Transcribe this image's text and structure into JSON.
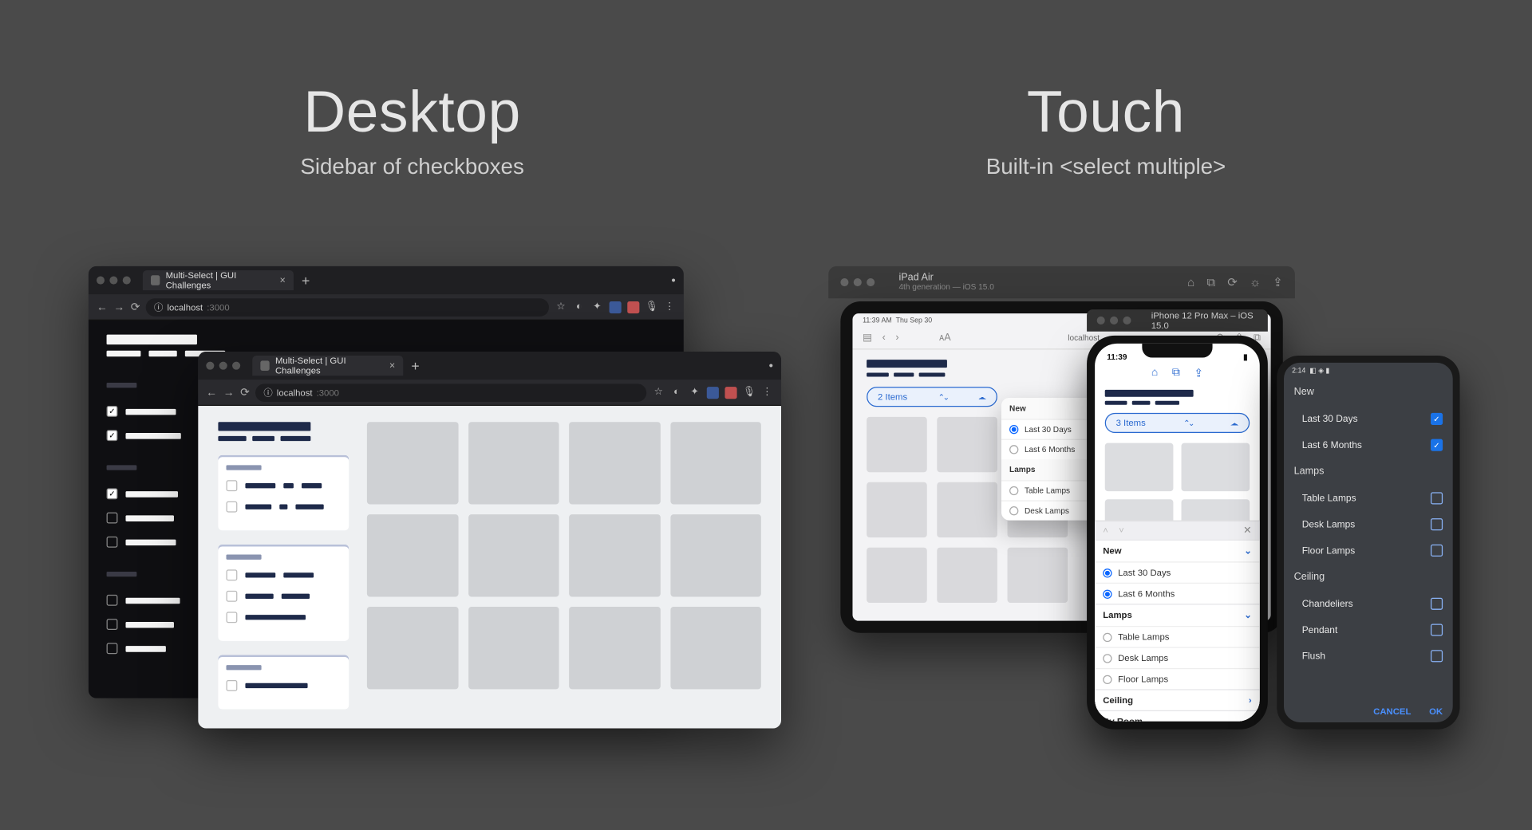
{
  "headings": {
    "desktop": {
      "title": "Desktop",
      "subtitle": "Sidebar of checkboxes"
    },
    "touch": {
      "title": "Touch",
      "subtitle": "Built-in <select multiple>"
    }
  },
  "browser": {
    "tab_title": "Multi-Select | GUI Challenges",
    "url_host": "localhost",
    "url_port": ":3000"
  },
  "simulator": {
    "ipad_name": "iPad Air",
    "ipad_detail": "4th generation — iOS 15.0",
    "iphone_name": "iPhone 12 Pro Max – iOS 15.0"
  },
  "ipad": {
    "status_time": "11:39 AM",
    "status_date": "Thu Sep 30",
    "url": "localhost",
    "pill_label": "2 Items",
    "popover": {
      "sections": [
        {
          "label": "New",
          "items": [
            {
              "label": "Last 30 Days",
              "selected": true
            },
            {
              "label": "Last 6 Months",
              "selected": false
            }
          ]
        },
        {
          "label": "Lamps",
          "items": [
            {
              "label": "Table Lamps",
              "selected": false
            },
            {
              "label": "Desk Lamps",
              "selected": false
            }
          ]
        }
      ]
    }
  },
  "iphone": {
    "time": "11:39",
    "pill_label": "3 Items",
    "sheet": {
      "sections": [
        {
          "label": "New",
          "expanded": true,
          "items": [
            {
              "label": "Last 30 Days",
              "selected": true
            },
            {
              "label": "Last 6 Months",
              "selected": true
            }
          ]
        },
        {
          "label": "Lamps",
          "expanded": true,
          "items": [
            {
              "label": "Table Lamps",
              "selected": false
            },
            {
              "label": "Desk Lamps",
              "selected": false
            },
            {
              "label": "Floor Lamps",
              "selected": false
            }
          ]
        },
        {
          "label": "Ceiling",
          "expanded": false,
          "items": []
        },
        {
          "label": "By Room",
          "expanded": false,
          "items": []
        }
      ]
    }
  },
  "android": {
    "time": "2:14",
    "sections": [
      {
        "label": "New",
        "items": [
          {
            "label": "Last 30 Days",
            "checked": true
          },
          {
            "label": "Last 6 Months",
            "checked": true
          }
        ]
      },
      {
        "label": "Lamps",
        "items": [
          {
            "label": "Table Lamps",
            "checked": false
          },
          {
            "label": "Desk Lamps",
            "checked": false
          },
          {
            "label": "Floor Lamps",
            "checked": false
          }
        ]
      },
      {
        "label": "Ceiling",
        "items": [
          {
            "label": "Chandeliers",
            "checked": false
          },
          {
            "label": "Pendant",
            "checked": false
          },
          {
            "label": "Flush",
            "checked": false
          }
        ]
      }
    ],
    "actions": {
      "cancel": "CANCEL",
      "ok": "OK"
    }
  }
}
